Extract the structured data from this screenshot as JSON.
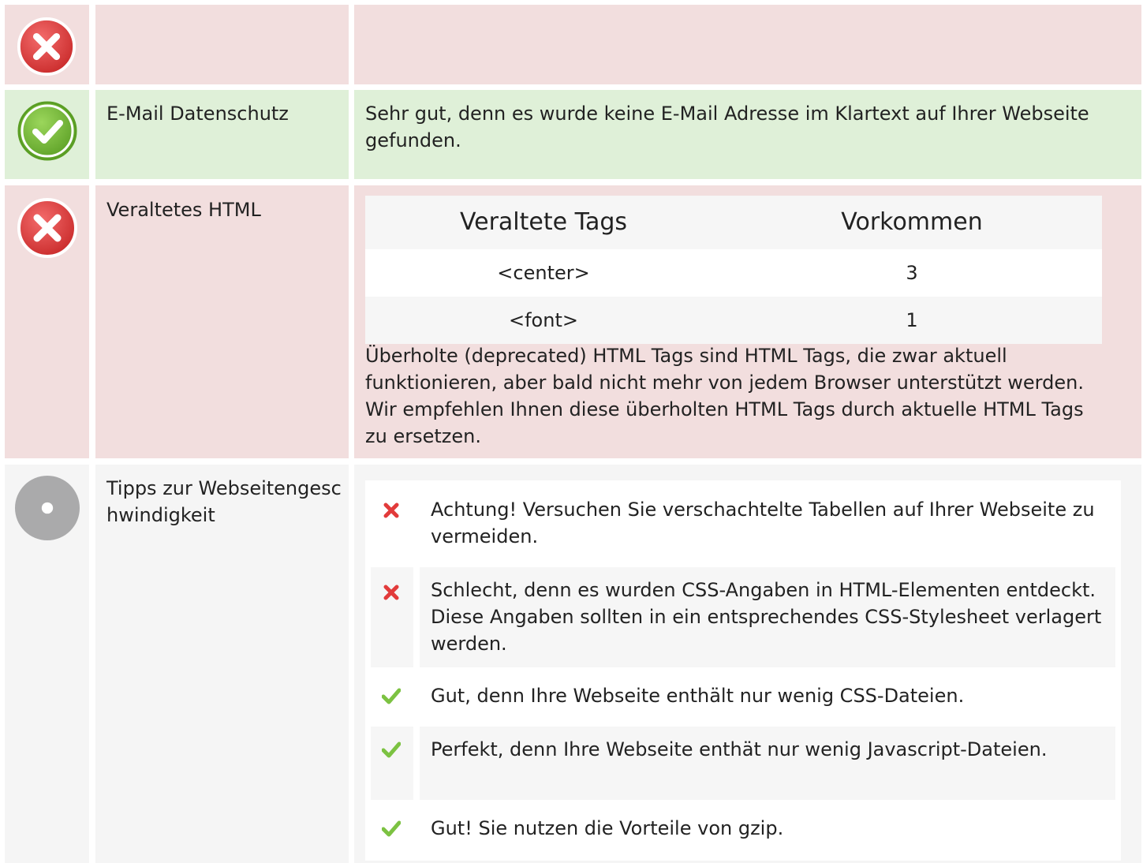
{
  "rows": [
    {
      "status": "error",
      "label": "",
      "text": ""
    },
    {
      "status": "success",
      "label": "E-Mail Datenschutz",
      "text": "Sehr gut, denn es wurde keine E-Mail Adresse im Klartext auf Ihrer Webseite gefunden."
    },
    {
      "status": "error",
      "label": "Veraltetes HTML",
      "table": {
        "headers": [
          "Veraltete Tags",
          "Vorkommen"
        ],
        "rows": [
          {
            "tag": "<center>",
            "count": "3"
          },
          {
            "tag": "<font>",
            "count": "1"
          }
        ]
      },
      "text": "Überholte (deprecated) HTML Tags sind HTML Tags, die zwar aktuell funktionieren, aber bald nicht mehr von jedem Browser unterstützt werden. Wir empfehlen Ihnen diese überholten HTML Tags durch aktuelle HTML Tags zu ersetzen."
    },
    {
      "status": "info",
      "label": "Tipps zur Webseitengeschwindigkeit",
      "tips": [
        {
          "status": "fail",
          "text": "Achtung! Versuchen Sie verschachtelte Tabellen auf Ihrer Webseite zu vermeiden."
        },
        {
          "status": "fail",
          "text": "Schlecht, denn es wurden CSS-Angaben in HTML-Elementen entdeckt. Diese Angaben sollten in ein entsprechendes CSS-Stylesheet verlagert werden."
        },
        {
          "status": "pass",
          "text": "Gut, denn Ihre Webseite enthält nur wenig CSS-Dateien."
        },
        {
          "status": "pass",
          "text": "Perfekt, denn Ihre Webseite enthät nur wenig Javascript-Dateien."
        },
        {
          "status": "pass",
          "text": "Gut! Sie nutzen die Vorteile von gzip."
        }
      ]
    }
  ],
  "icons": {
    "error": "error-circle-icon",
    "success": "success-check-circle-icon",
    "info": "neutral-circle-icon",
    "fail": "red-cross-icon",
    "pass": "green-check-icon"
  },
  "colors": {
    "bad_bg": "#f2dede",
    "good_bg": "#dff0d8",
    "neutral_bg": "#f5f5f5",
    "error_red": "#e23b3b",
    "success_green": "#7cc242",
    "neutral_gray": "#aaaaab"
  }
}
